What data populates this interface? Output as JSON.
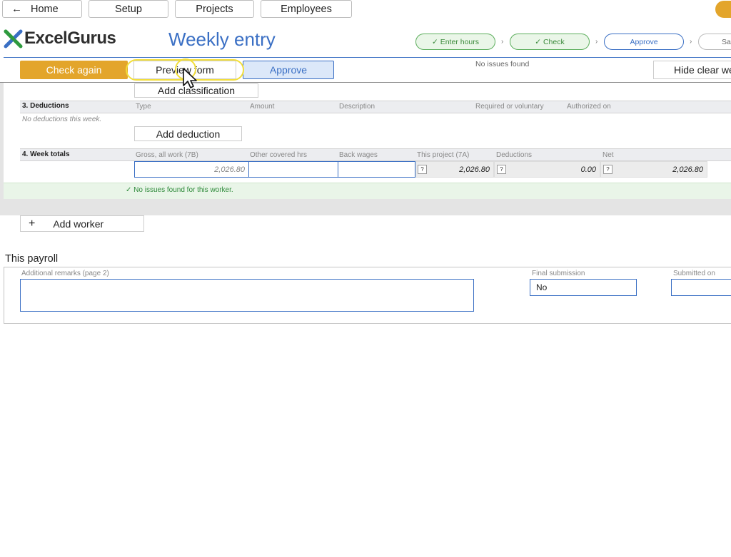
{
  "nav": {
    "home_label": "Home",
    "setup_label": "Setup",
    "projects_label": "Projects",
    "employees_label": "Employees"
  },
  "brand": {
    "name": "ExcelGurus",
    "accent": "#3a6fc4",
    "green": "#2e9a3e",
    "orange": "#e3a52b"
  },
  "page_title": "Weekly entry",
  "steps": [
    {
      "label": "✓ Enter hours",
      "state": "done"
    },
    {
      "label": "✓ Check",
      "state": "done"
    },
    {
      "label": "Approve",
      "state": "current"
    },
    {
      "label": "Sa",
      "state": "todo"
    }
  ],
  "toolbar": {
    "check_again": "Check again",
    "preview_form": "Preview form",
    "approve": "Approve",
    "status": "No issues found",
    "hide_clear": "Hide clear we"
  },
  "classification": {
    "add_label": "Add classification"
  },
  "deductions": {
    "title": "3. Deductions",
    "columns": [
      "Type",
      "Amount",
      "Description",
      "Required or voluntary",
      "Authorized on"
    ],
    "empty_text": "No deductions this week.",
    "add_label": "Add deduction"
  },
  "totals": {
    "title": "4. Week totals",
    "columns": [
      "Gross, all work (7B)",
      "Other covered hrs",
      "Back wages",
      "This project (7A)",
      "Deductions",
      "Net"
    ],
    "gross": "2,026.80",
    "other_hours": "",
    "back_wages": "",
    "this_project": "2,026.80",
    "deductions": "0.00",
    "net": "2,026.80",
    "help": "?"
  },
  "worker_status": "No issues found for this worker.",
  "add_worker": {
    "plus": "+",
    "label": "Add worker"
  },
  "payroll": {
    "heading": "This payroll",
    "remarks_label": "Additional remarks (page 2)",
    "remarks_value": "",
    "final_label": "Final submission",
    "final_value": "No",
    "submitted_label": "Submitted on",
    "submitted_value": ""
  }
}
